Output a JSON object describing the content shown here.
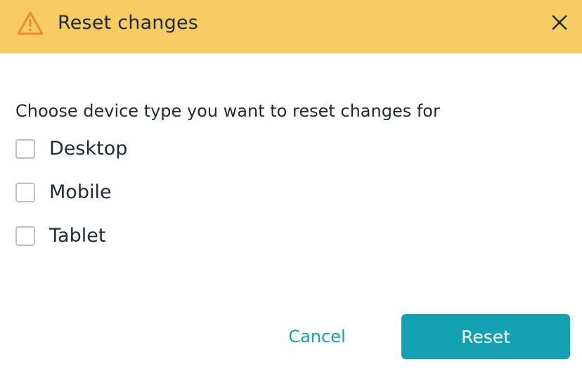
{
  "header": {
    "title": "Reset changes",
    "icon": "warning-triangle-icon",
    "close_icon": "close-icon",
    "background_color": "#f6cc63"
  },
  "body": {
    "prompt": "Choose device type you want to reset changes for",
    "options": [
      {
        "label": "Desktop",
        "checked": false
      },
      {
        "label": "Mobile",
        "checked": false
      },
      {
        "label": "Tablet",
        "checked": false
      }
    ]
  },
  "footer": {
    "cancel_label": "Cancel",
    "reset_label": "Reset",
    "accent_color": "#14a1b3"
  }
}
